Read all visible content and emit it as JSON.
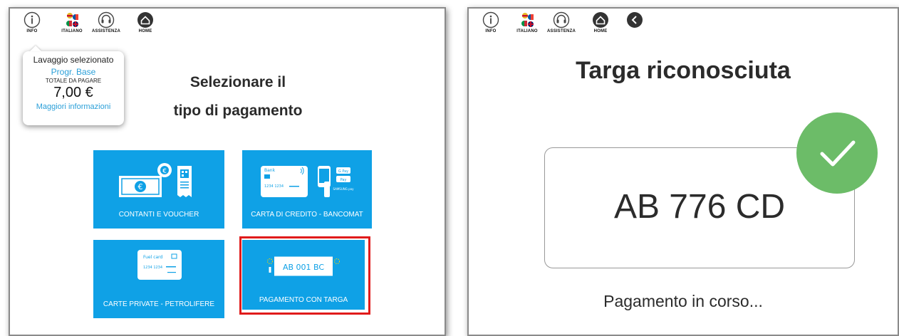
{
  "colors": {
    "tile_blue": "#0fa1e6",
    "accent_blue": "#2a9fd8",
    "highlight_red": "#e01b1b",
    "success_green": "#6cbc68"
  },
  "left": {
    "topbar": [
      {
        "icon": "info-icon",
        "label": "INFO"
      },
      {
        "icon": "flags-icon",
        "label": "ITALIANO"
      },
      {
        "icon": "headset-icon",
        "label": "ASSISTENZA"
      },
      {
        "icon": "home-icon",
        "label": "HOME"
      }
    ],
    "tooltip": {
      "title": "Lavaggio selezionato",
      "program": "Progr. Base",
      "total_label": "TOTALE DA PAGARE",
      "price": "7,00 €",
      "more": "Maggiori informazioni"
    },
    "title_line1": "Selezionare il",
    "title_line2": "tipo di pagamento",
    "tiles": {
      "cash": {
        "label": "CONTANTI E VOUCHER",
        "icon": "cash-voucher-icon"
      },
      "card": {
        "label": "CARTA DI CREDITO - BANCOMAT",
        "icon": "credit-card-icon",
        "card_bank": "Bank",
        "card_number": "1234 1234",
        "wallets": [
          "G Pay",
          "Pay",
          "SAMSUNG pay"
        ]
      },
      "fuel": {
        "label": "CARTE PRIVATE - PETROLIFERE",
        "icon": "fuel-card-icon",
        "card_title": "Fuel card",
        "card_number": "1234 1234"
      },
      "plate": {
        "label": "PAGAMENTO CON TARGA",
        "icon": "license-plate-icon",
        "plate_text": "AB 001 BC",
        "selected": true
      }
    }
  },
  "right": {
    "topbar": [
      {
        "icon": "info-icon",
        "label": "INFO"
      },
      {
        "icon": "flags-icon",
        "label": "ITALIANO"
      },
      {
        "icon": "headset-icon",
        "label": "ASSISTENZA"
      },
      {
        "icon": "home-icon",
        "label": "HOME"
      },
      {
        "icon": "back-icon",
        "label": ""
      }
    ],
    "title": "Targa riconosciuta",
    "plate": "AB 776 CD",
    "status": "Pagamento in corso..."
  }
}
